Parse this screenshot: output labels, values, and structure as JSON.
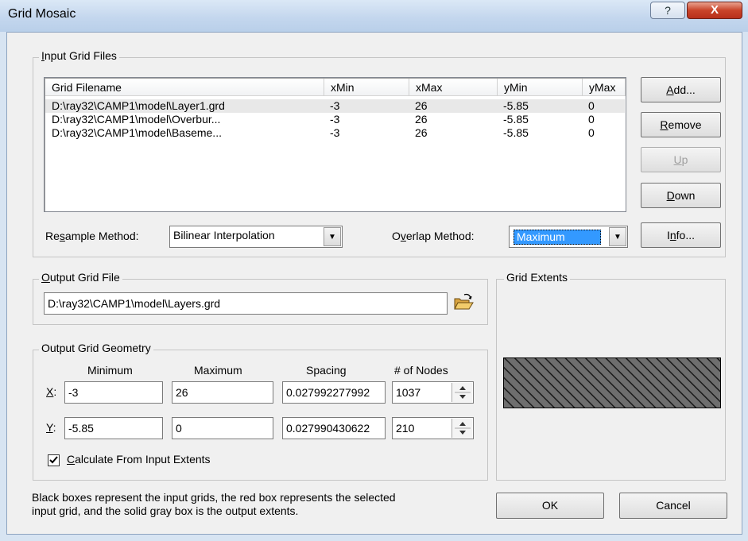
{
  "window": {
    "title": "Grid Mosaic",
    "help_glyph": "?",
    "close_glyph": "X"
  },
  "input_grid_files": {
    "legend": "Input Grid Files",
    "columns": [
      "Grid Filename",
      "xMin",
      "xMax",
      "yMin",
      "yMax"
    ],
    "rows": [
      [
        "D:\\ray32\\CAMP1\\model\\Layer1.grd",
        "-3",
        "26",
        "-5.85",
        "0"
      ],
      [
        "D:\\ray32\\CAMP1\\model\\Overbur...",
        "-3",
        "26",
        "-5.85",
        "0"
      ],
      [
        "D:\\ray32\\CAMP1\\model\\Baseme...",
        "-3",
        "26",
        "-5.85",
        "0"
      ]
    ],
    "buttons": {
      "add": "Add...",
      "remove": "Remove",
      "up": "Up",
      "down": "Down",
      "info": "Info..."
    },
    "resample_label": "Resample Method:",
    "resample_value": "Bilinear Interpolation",
    "overlap_label": "Overlap Method:",
    "overlap_value": "Maximum"
  },
  "output_grid_file": {
    "legend": "Output Grid File",
    "path": "D:\\ray32\\CAMP1\\model\\Layers.grd",
    "browse_icon": "folder-open-icon"
  },
  "geometry": {
    "legend": "Output Grid Geometry",
    "headers": {
      "minimum": "Minimum",
      "maximum": "Maximum",
      "spacing": "Spacing",
      "nodes": "# of Nodes"
    },
    "x": {
      "label": "X:",
      "min": "-3",
      "max": "26",
      "spacing": "0.027992277992",
      "nodes": "1037"
    },
    "y": {
      "label": "Y:",
      "min": "-5.85",
      "max": "0",
      "spacing": "0.027990430622",
      "nodes": "210"
    },
    "calc_checked": true,
    "calc_label": "Calculate From Input Extents"
  },
  "extents": {
    "legend": "Grid Extents"
  },
  "footer": {
    "note_line1": "Black boxes represent the input grids, the red box represents the selected",
    "note_line2": "input grid, and the solid gray box is the output extents.",
    "ok": "OK",
    "cancel": "Cancel"
  }
}
